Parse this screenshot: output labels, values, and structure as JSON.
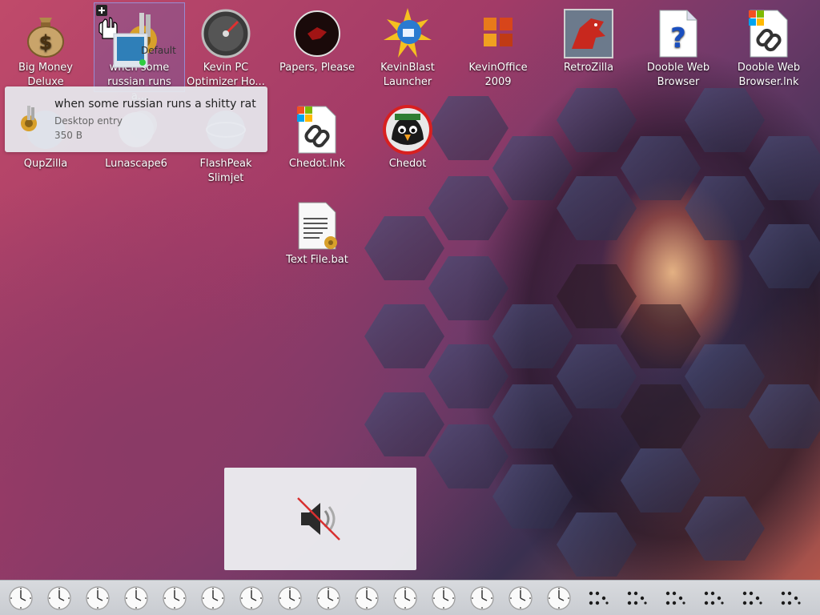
{
  "desktop": {
    "icons_row1": [
      {
        "name": "big-money-deluxe",
        "label": "Big Money Deluxe",
        "icon": "money-bag-icon"
      },
      {
        "name": "when-some-russian",
        "label": "when some russian runs a...",
        "icon": "gear-icon"
      },
      {
        "name": "kevin-pc-optimizer",
        "label": "Kevin PC Optimizer Ho...",
        "icon": "speedometer-icon"
      },
      {
        "name": "papers-please",
        "label": "Papers, Please",
        "icon": "papers-please-icon"
      },
      {
        "name": "kevinblast-launcher",
        "label": "KevinBlast Launcher",
        "icon": "globe-sun-icon"
      },
      {
        "name": "kevinoffice-2009",
        "label": "KevinOffice 2009",
        "icon": "office-icon"
      },
      {
        "name": "retrozilla",
        "label": "RetroZilla",
        "icon": "dragon-icon"
      },
      {
        "name": "dooble-web-browser",
        "label": "Dooble Web Browser",
        "icon": "question-doc-icon"
      },
      {
        "name": "dooble-web-browser-lnk",
        "label": "Dooble Web Browser.lnk",
        "icon": "link-doc-icon"
      }
    ],
    "icons_row2": [
      {
        "name": "qupzilla",
        "label": "QupZilla",
        "icon": "globe-icon"
      },
      {
        "name": "lunascape6",
        "label": "Lunascape6",
        "icon": "moon-icon"
      },
      {
        "name": "flashpeak-slimjet",
        "label": "FlashPeak Slimjet",
        "icon": "globe-icon"
      },
      {
        "name": "chedot-lnk",
        "label": "Chedot.lnk",
        "icon": "link-doc-icon"
      },
      {
        "name": "chedot",
        "label": "Chedot",
        "icon": "bird-icon"
      }
    ],
    "icons_row3": [
      {
        "name": "text-file-bat",
        "label": "Text File.bat",
        "icon": "batch-file-icon"
      }
    ],
    "drag_label": "Default"
  },
  "tooltip": {
    "title": "when some russian runs a shitty rat",
    "type": "Desktop entry",
    "size": "350 B"
  },
  "osd": {
    "icon": "speaker-muted-icon"
  },
  "taskbar": {
    "clock_count": 15,
    "dots_count": 6
  },
  "colors": {
    "taskbar": "#c9ccd1",
    "osd": "#ecedf0",
    "tooltip": "#e6e8ee",
    "selection": "#506ec8"
  }
}
